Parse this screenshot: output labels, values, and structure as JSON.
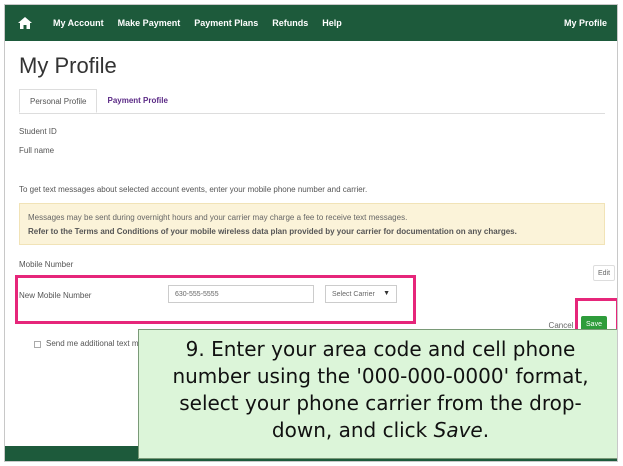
{
  "nav": {
    "home_icon": "home-icon",
    "items": [
      "My Account",
      "Make Payment",
      "Payment Plans",
      "Refunds",
      "Help"
    ],
    "right": "My Profile"
  },
  "page": {
    "title": "My Profile"
  },
  "tabs": [
    {
      "label": "Personal Profile",
      "active": true
    },
    {
      "label": "Payment Profile",
      "active": false
    }
  ],
  "fields": {
    "student_id_label": "Student ID",
    "full_name_label": "Full name"
  },
  "intro_text": "To get text messages about selected account events, enter your mobile phone number and carrier.",
  "notice": {
    "line1": "Messages may be sent during overnight hours and your carrier may charge a fee to receive text messages.",
    "line2": "Refer to the Terms and Conditions of your mobile wireless data plan provided by your carrier for documentation on any charges."
  },
  "mobile": {
    "section_label": "Mobile Number",
    "edit_label": "Edit",
    "new_label": "New Mobile Number",
    "phone_value": "630-555-5555",
    "carrier_selected": "Select Carrier"
  },
  "actions": {
    "cancel": "Cancel",
    "save": "Save"
  },
  "checkbox_label": "Send me additional text me",
  "callout": {
    "line1": "9. Enter your area code and cell phone",
    "line2": "number using the '000-000-0000' format,",
    "line3": "select your phone carrier from the drop-",
    "line4_a": "down, and click ",
    "line4_em": "Save",
    "line4_b": "."
  },
  "colors": {
    "nav": "#1d5a3b",
    "highlight": "#e6267a",
    "save": "#2e9c3b",
    "callout_bg": "#dcf5d9",
    "notice_bg": "#fbf3d9"
  }
}
